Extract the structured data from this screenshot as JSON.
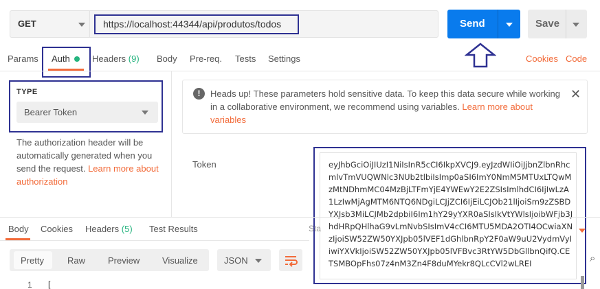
{
  "request": {
    "method": "GET",
    "url": "https://localhost:44344/api/produtos/todos",
    "send_label": "Send",
    "save_label": "Save"
  },
  "tabs": [
    {
      "label": "Params"
    },
    {
      "label": "Auth"
    },
    {
      "label": "Headers",
      "count": "(9)"
    },
    {
      "label": "Body"
    },
    {
      "label": "Pre-req."
    },
    {
      "label": "Tests"
    },
    {
      "label": "Settings"
    }
  ],
  "tab_links": {
    "cookies": "Cookies",
    "code": "Code"
  },
  "auth": {
    "type_label": "TYPE",
    "type_value": "Bearer Token",
    "description": "The authorization header will be automatically generated when you send the request. ",
    "learn_more": "Learn more about authorization"
  },
  "notice": {
    "text": "Heads up! These parameters hold sensitive data. To keep this data secure while working in a collaborative environment, we recommend using variables. ",
    "link": "Learn more about variables",
    "close": "✕"
  },
  "token": {
    "label": "Token",
    "value": "eyJhbGciOiJIUzI1NiIsInR5cCI6IkpXVCJ9.eyJzdWIiOiJjbnZlbnRhcmlvTmVUQWNlc3NUb2tlbiIsImp0aSI6ImY0NmM5MTUxLTQwMzMtNDhmMC04MzBjLTFmYjE4YWEwY2E2ZSIsImlhdCI6IjIwLzA1LzIwMjAgMTM6NTQ6NDgiLCJjZCI6IjEiLCJOb21lIjoiSm9zZSBDYXJsb3MiLCJMb2dpbiI6Im1hY29yYXR0aSIsIkVtYWlsIjoibWFjb3JhdHRpQHlhaG9vLmNvbSIsImV4cCI6MTU5MDA2OTI4OCwiaXNzIjoiSW52ZW50YXJpb05lVEF1dGhlbnRpY2F0aW9uU2VydmVyIiwiYXVkIjoiSW52ZW50YXJpb05lVFBvc3RtYW5DbGllbnQifQ.CETSMBOpFhs07z4nM3Zn4F8duMYekr8QLcCVl2wLREI"
  },
  "response": {
    "tabs": [
      {
        "label": "Body"
      },
      {
        "label": "Cookies"
      },
      {
        "label": "Headers",
        "count": "(5)"
      },
      {
        "label": "Test Results"
      }
    ],
    "status_partial": "Sta",
    "formats": [
      "Pretty",
      "Raw",
      "Preview",
      "Visualize"
    ],
    "language": "JSON",
    "line_number": "1",
    "code_first": "["
  },
  "colors": {
    "accent": "#f26b3a",
    "send_blue": "#097bed",
    "count_green": "#26b47f",
    "highlight_outline": "#2e3192"
  },
  "icons": [
    "caret-down-icon",
    "info-icon",
    "close-icon",
    "wrap-lines-icon",
    "search-icon",
    "up-arrow-annotation"
  ]
}
